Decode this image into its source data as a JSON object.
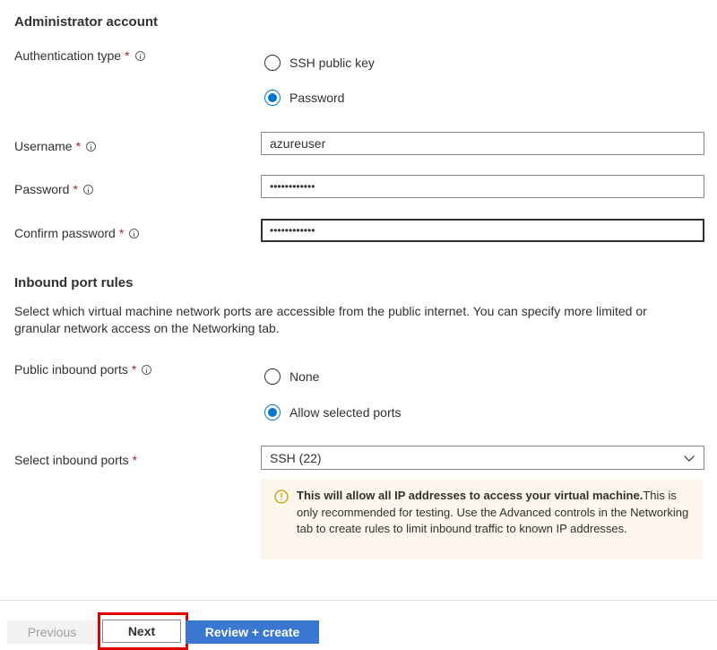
{
  "admin": {
    "title": "Administrator account",
    "auth_type": {
      "label": "Authentication type",
      "required_mark": "*",
      "options": [
        "SSH public key",
        "Password"
      ],
      "selected": "Password"
    },
    "username": {
      "label": "Username",
      "required_mark": "*",
      "value": "azureuser"
    },
    "password": {
      "label": "Password",
      "required_mark": "*",
      "value": "••••••••••••"
    },
    "confirm_password": {
      "label": "Confirm password",
      "required_mark": "*",
      "value": "••••••••••••"
    }
  },
  "inbound": {
    "title": "Inbound port rules",
    "description": "Select which virtual machine network ports are accessible from the public internet. You can specify more limited or granular network access on the Networking tab.",
    "public_ports": {
      "label": "Public inbound ports",
      "required_mark": "*",
      "options": [
        "None",
        "Allow selected ports"
      ],
      "selected": "Allow selected ports"
    },
    "select_ports": {
      "label": "Select inbound ports",
      "required_mark": "*",
      "value": "SSH (22)"
    },
    "warning": {
      "bold": "This will allow all IP addresses to access your virtual machine.",
      "text": "This is only recommended for testing. Use the Advanced controls in the Networking tab to create rules to limit inbound traffic to known IP addresses."
    }
  },
  "footer": {
    "previous_label": "Previous",
    "next_label": "Next",
    "review_label": "Review + create"
  },
  "colors": {
    "accent": "#0078d4",
    "primary_button": "#3a77d0",
    "warning_bg": "#fdf6ed",
    "warning_icon": "#c19c00",
    "highlight_box": "#e00000"
  }
}
